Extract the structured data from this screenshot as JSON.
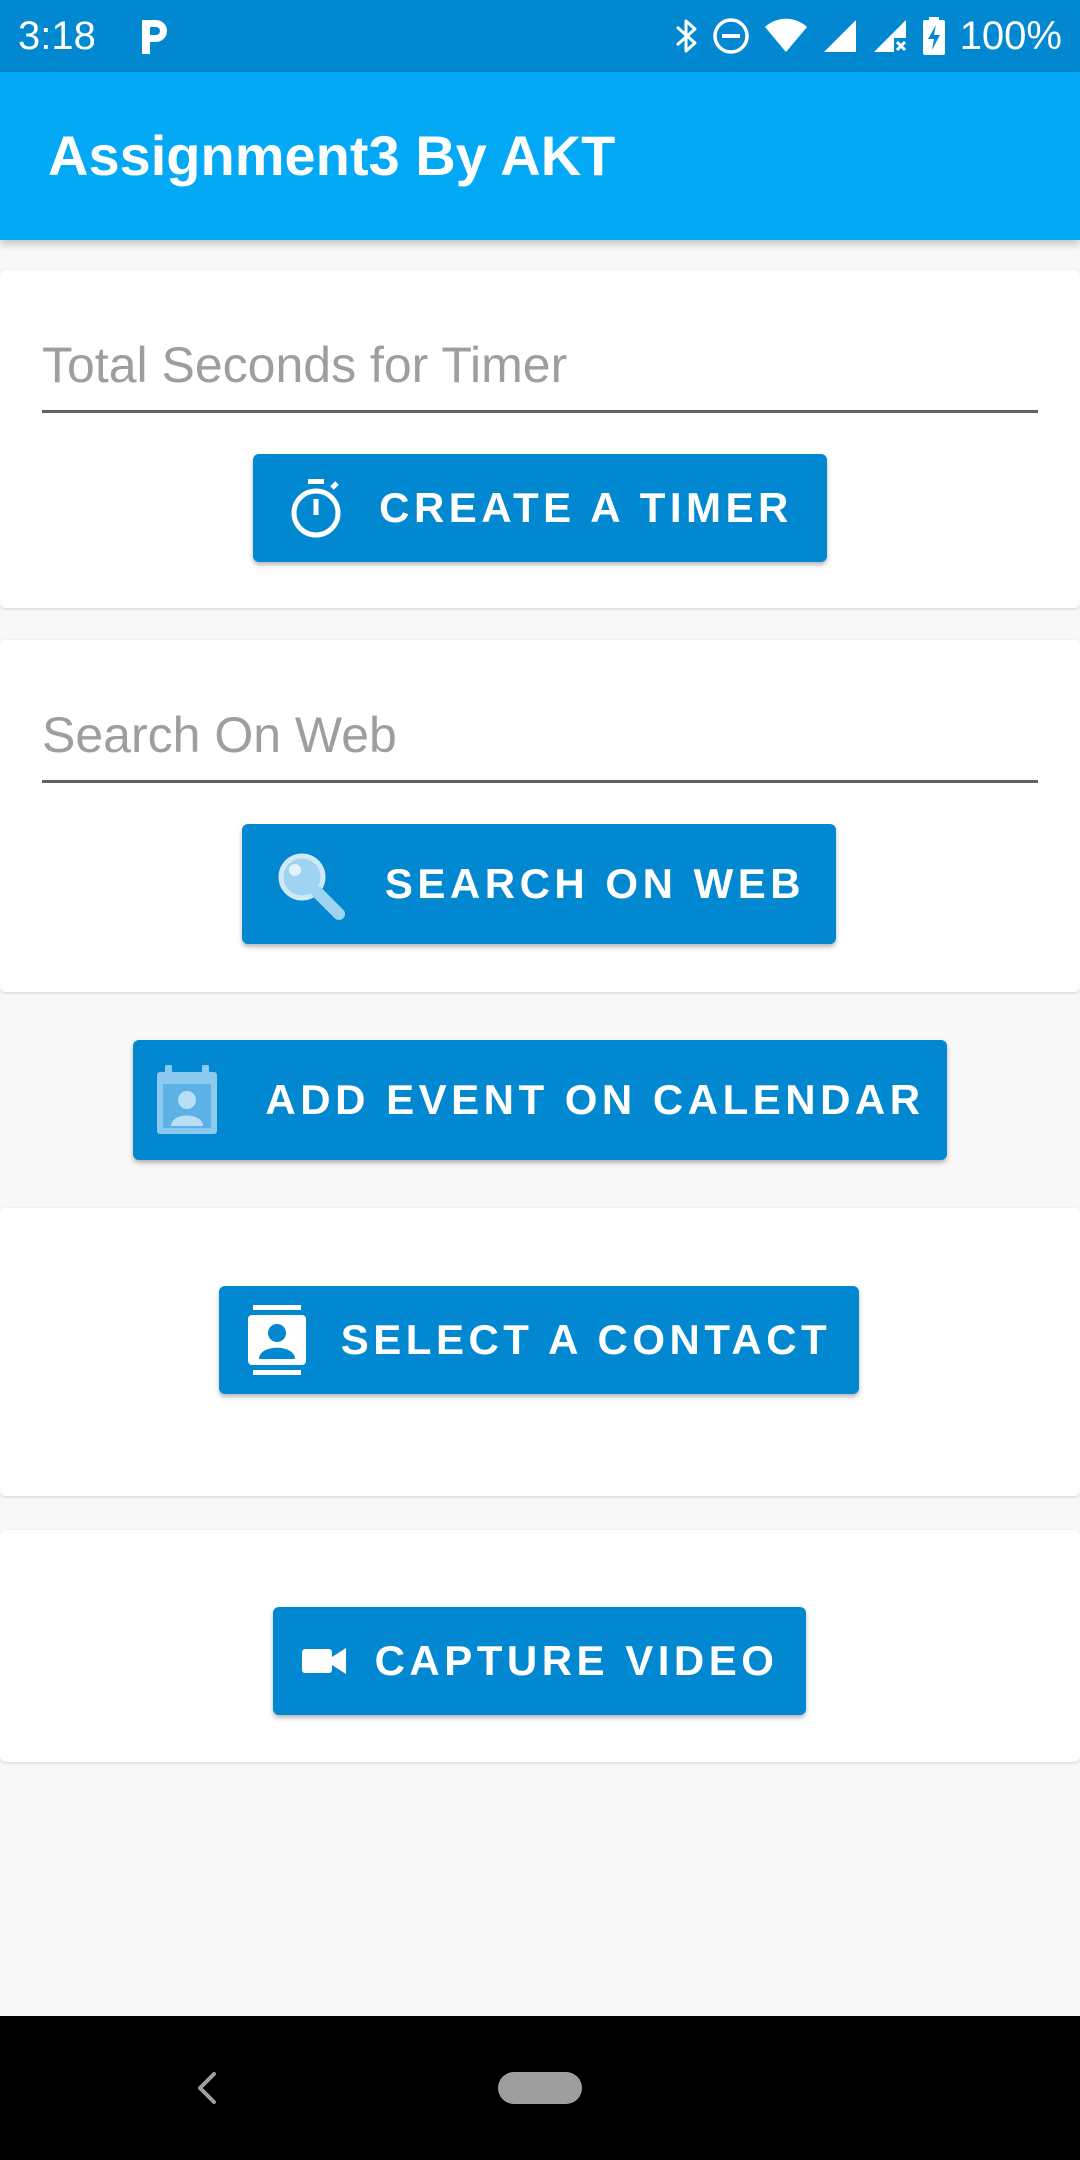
{
  "status_bar": {
    "time": "3:18",
    "battery_percent": "100%",
    "icons": [
      "parking-icon",
      "bluetooth-icon",
      "do-not-disturb-icon",
      "wifi-icon",
      "signal-icon",
      "signal-no-data-icon",
      "battery-charging-icon"
    ]
  },
  "app_bar": {
    "title": "Assignment3 By AKT",
    "color": "#03a9f4"
  },
  "timer_card": {
    "input_placeholder": "Total Seconds for Timer",
    "input_value": "",
    "button_label": "CREATE A TIMER",
    "button_icon": "stopwatch-icon"
  },
  "search_card": {
    "input_placeholder": "Search On Web",
    "input_value": "",
    "button_label": "SEARCH ON WEB",
    "button_icon": "search-icon"
  },
  "calendar": {
    "button_label": "ADD EVENT ON CALENDAR",
    "button_icon": "calendar-contact-icon"
  },
  "contact_card": {
    "button_label": "SELECT A CONTACT",
    "button_icon": "contact-card-icon"
  },
  "video_card": {
    "button_label": "CAPTURE VIDEO",
    "button_icon": "video-camera-icon"
  },
  "nav_bar": {
    "buttons": [
      "back",
      "home"
    ]
  },
  "colors": {
    "status_bar": "#0288d1",
    "app_bar": "#03a9f4",
    "button": "#0288d1",
    "background": "#f8f8f8"
  }
}
